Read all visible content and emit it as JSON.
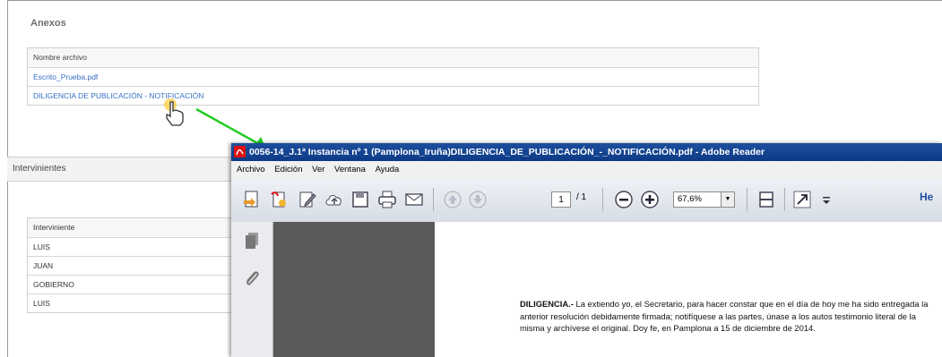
{
  "anexos": {
    "title": "Anexos",
    "header": "Nombre archivo",
    "files": [
      "Escrito_Prueba.pdf",
      "DILIGENCIA DE PUBLICACIÓN - NOTIFICACIÓN"
    ]
  },
  "intervinientes": {
    "title": "Intervinientes",
    "header": "Interviniente",
    "rows": [
      "LUIS",
      "JUAN",
      "GOBIERNO",
      "LUIS"
    ]
  },
  "reader": {
    "window_title": "0056-14_J.1ª Instancia nº 1 (Pamplona_Iruña)DILIGENCIA_DE_PUBLICACIÓN_-_NOTIFICACIÓN.pdf - Adobe Reader",
    "menu": [
      "Archivo",
      "Edición",
      "Ver",
      "Ventana",
      "Ayuda"
    ],
    "page_current": "1",
    "page_total": "/ 1",
    "zoom": "67,6%",
    "tools_label": "He",
    "doc_heading": "DILIGENCIA.-",
    "doc_body": " La extiendo yo, el Secretario, para hacer constar que en el día de hoy me ha sido entregada la anterior resolución debidamente firmada; notifíquese a las partes, únase a los autos testimonio literal de la misma y archívese el original. Doy fe, en Pamplona a 15 de diciembre de 2014."
  },
  "colors": {
    "title_bar": "#1d4f9e",
    "link": "#3a6fc4",
    "arrow": "#22cc22"
  }
}
